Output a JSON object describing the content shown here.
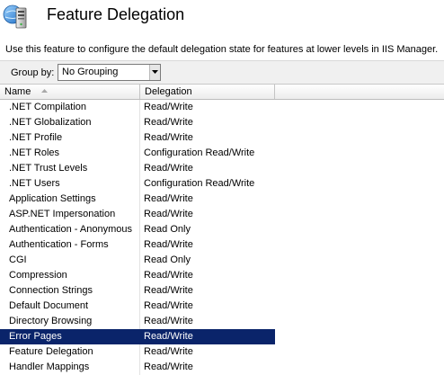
{
  "header": {
    "title": "Feature Delegation",
    "icon": "feature-delegation-server-icon"
  },
  "description": "Use this feature to configure the default delegation state for features at lower levels in IIS Manager.",
  "toolbar": {
    "group_by_label": "Group by:",
    "group_by_value": "No Grouping"
  },
  "grid": {
    "columns": [
      {
        "label": "Name",
        "sorted": "ascending"
      },
      {
        "label": "Delegation"
      }
    ],
    "rows": [
      {
        "name": ".NET Compilation",
        "delegation": "Read/Write"
      },
      {
        "name": ".NET Globalization",
        "delegation": "Read/Write"
      },
      {
        "name": ".NET Profile",
        "delegation": "Read/Write"
      },
      {
        "name": ".NET Roles",
        "delegation": "Configuration Read/Write"
      },
      {
        "name": ".NET Trust Levels",
        "delegation": "Read/Write"
      },
      {
        "name": ".NET Users",
        "delegation": "Configuration Read/Write"
      },
      {
        "name": "Application Settings",
        "delegation": "Read/Write"
      },
      {
        "name": "ASP.NET Impersonation",
        "delegation": "Read/Write"
      },
      {
        "name": "Authentication - Anonymous",
        "delegation": "Read Only"
      },
      {
        "name": "Authentication - Forms",
        "delegation": "Read/Write"
      },
      {
        "name": "CGI",
        "delegation": "Read Only"
      },
      {
        "name": "Compression",
        "delegation": "Read/Write"
      },
      {
        "name": "Connection Strings",
        "delegation": "Read/Write"
      },
      {
        "name": "Default Document",
        "delegation": "Read/Write"
      },
      {
        "name": "Directory Browsing",
        "delegation": "Read/Write"
      },
      {
        "name": "Error Pages",
        "delegation": "Read/Write",
        "selected": true
      },
      {
        "name": "Feature Delegation",
        "delegation": "Read/Write"
      },
      {
        "name": "Handler Mappings",
        "delegation": "Read/Write"
      }
    ]
  },
  "colors": {
    "selection": "#0a246a",
    "toolbar": "#f0f0f0"
  }
}
